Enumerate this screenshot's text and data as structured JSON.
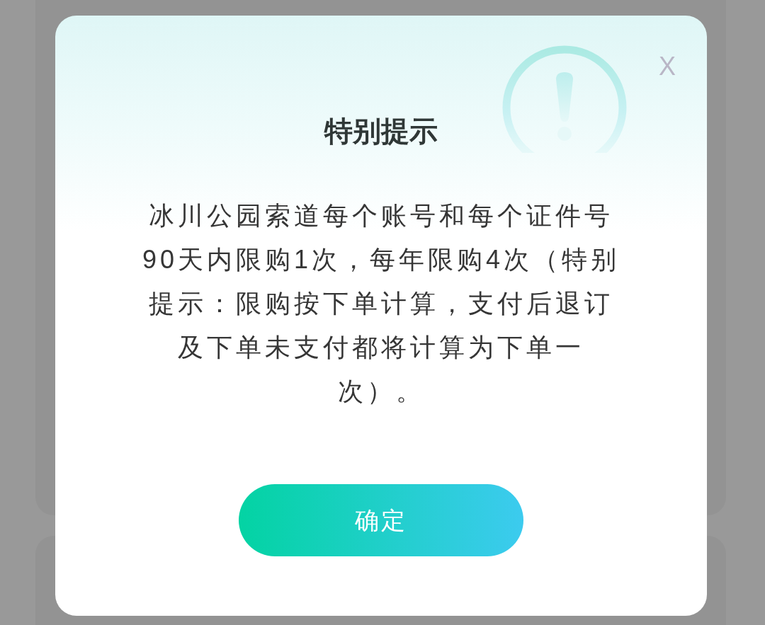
{
  "dialog": {
    "title": "特别提示",
    "close": "X",
    "message": "冰川公园索道每个账号和每个证件号90天内限购1次，每年限购4次（特别提示：限购按下单计算，支付后退订及下单未支付都将计算为下单一次）。",
    "confirm_button": "确定"
  }
}
